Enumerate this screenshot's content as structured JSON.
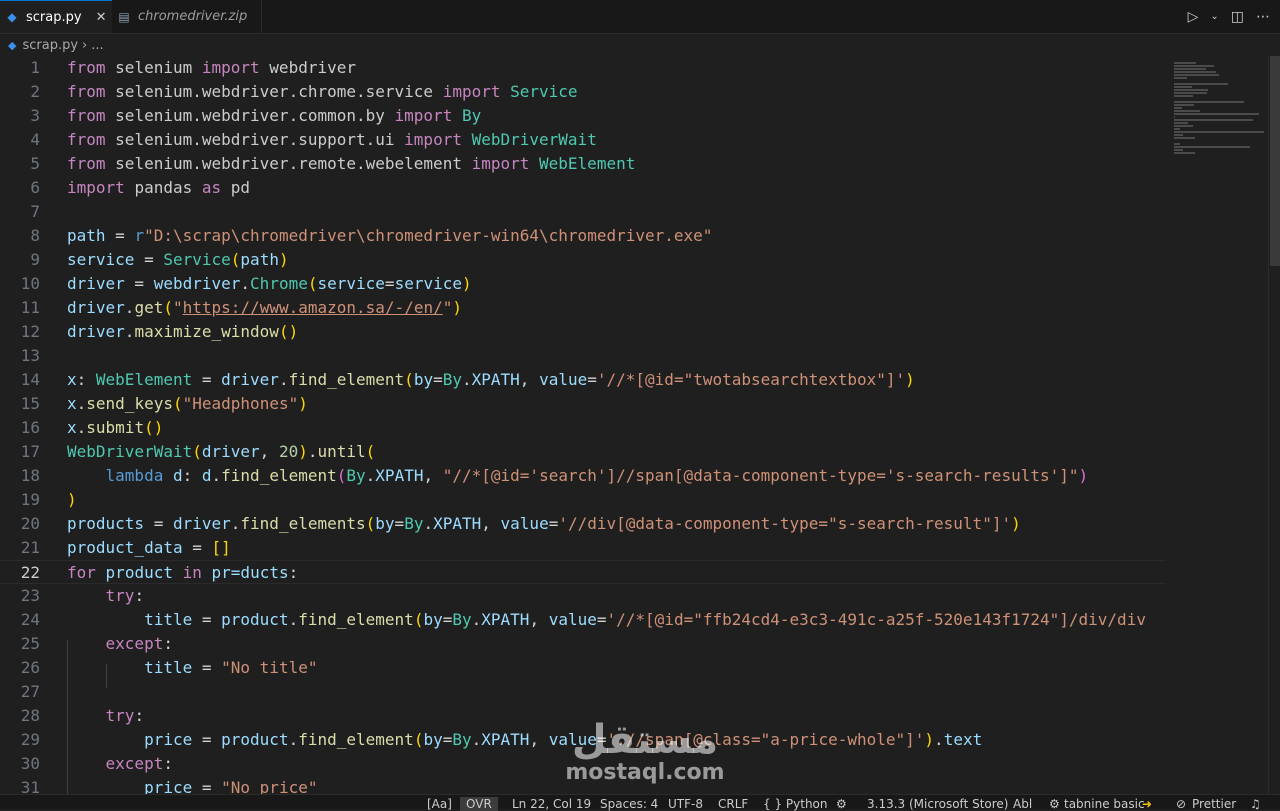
{
  "tabs": [
    {
      "label": "scrap.py",
      "active": true,
      "icon": "python-file-icon"
    },
    {
      "label": "chromedriver.zip",
      "active": false,
      "icon": "zip-file-icon"
    }
  ],
  "breadcrumb": {
    "file": "scrap.py",
    "more": "..."
  },
  "editor": {
    "current_line": "22"
  },
  "code_lines": [
    {
      "n": "1",
      "parts": [
        [
          "kw",
          "from"
        ],
        [
          "",
          "selenium"
        ],
        [
          "kw",
          "import"
        ],
        [
          "",
          "webdriver"
        ]
      ]
    },
    {
      "n": "2",
      "parts": [
        [
          "kw",
          "from"
        ],
        [
          "",
          "selenium.webdriver.chrome.service"
        ],
        [
          "kw",
          "import"
        ],
        [
          "cls",
          "Service"
        ]
      ]
    },
    {
      "n": "3",
      "parts": [
        [
          "kw",
          "from"
        ],
        [
          "",
          "selenium.webdriver.common.by"
        ],
        [
          "kw",
          "import"
        ],
        [
          "cls",
          "By"
        ]
      ]
    },
    {
      "n": "4",
      "parts": [
        [
          "kw",
          "from"
        ],
        [
          "",
          "selenium.webdriver.support.ui"
        ],
        [
          "kw",
          "import"
        ],
        [
          "cls",
          "WebDriverWait"
        ]
      ]
    },
    {
      "n": "5",
      "parts": [
        [
          "kw",
          "from"
        ],
        [
          "",
          "selenium.webdriver.remote.webelement"
        ],
        [
          "kw",
          "import"
        ],
        [
          "cls",
          "WebElement"
        ]
      ]
    },
    {
      "n": "6",
      "parts": [
        [
          "kw",
          "import"
        ],
        [
          "",
          "pandas"
        ],
        [
          "kw",
          "as"
        ],
        [
          "",
          "pd"
        ]
      ]
    },
    {
      "n": "7",
      "parts": []
    },
    {
      "n": "8",
      "parts": [
        [
          "var",
          "path"
        ],
        [
          "op",
          " = "
        ],
        [
          "kb",
          "r"
        ],
        [
          "str",
          "\"D:\\scrap\\chromedriver\\chromedriver-win64\\chromedriver.exe\""
        ]
      ]
    },
    {
      "n": "9",
      "parts": [
        [
          "var",
          "service"
        ],
        [
          "op",
          " = "
        ],
        [
          "cls",
          "Service"
        ],
        [
          "b1",
          "("
        ],
        [
          "var",
          "path"
        ],
        [
          "b1",
          ")"
        ]
      ]
    },
    {
      "n": "10",
      "parts": [
        [
          "var",
          "driver"
        ],
        [
          "op",
          " = "
        ],
        [
          "var",
          "webdriver"
        ],
        [
          "op",
          "."
        ],
        [
          "cls",
          "Chrome"
        ],
        [
          "b1",
          "("
        ],
        [
          "var",
          "service"
        ],
        [
          "op",
          "="
        ],
        [
          "var",
          "service"
        ],
        [
          "b1",
          ")"
        ]
      ]
    },
    {
      "n": "11",
      "parts": [
        [
          "var",
          "driver"
        ],
        [
          "op",
          "."
        ],
        [
          "fn",
          "get"
        ],
        [
          "b1",
          "("
        ],
        [
          "str",
          "\""
        ],
        [
          "str und",
          "https://www.amazon.sa/-/en/"
        ],
        [
          "str",
          "\""
        ],
        [
          "b1",
          ")"
        ]
      ]
    },
    {
      "n": "12",
      "parts": [
        [
          "var",
          "driver"
        ],
        [
          "op",
          "."
        ],
        [
          "fn",
          "maximize_window"
        ],
        [
          "b1",
          "()"
        ]
      ]
    },
    {
      "n": "13",
      "parts": []
    },
    {
      "n": "14",
      "parts": [
        [
          "var",
          "x"
        ],
        [
          "op",
          ": "
        ],
        [
          "cls",
          "WebElement"
        ],
        [
          "op",
          " = "
        ],
        [
          "var",
          "driver"
        ],
        [
          "op",
          "."
        ],
        [
          "fn",
          "find_element"
        ],
        [
          "b1",
          "("
        ],
        [
          "var",
          "by"
        ],
        [
          "op",
          "="
        ],
        [
          "cls",
          "By"
        ],
        [
          "op",
          "."
        ],
        [
          "var",
          "XPATH"
        ],
        [
          "op",
          ", "
        ],
        [
          "var",
          "value"
        ],
        [
          "op",
          "="
        ],
        [
          "str",
          "'//*[@id=\"twotabsearchtextbox\"]'"
        ],
        [
          "b1",
          ")"
        ]
      ]
    },
    {
      "n": "15",
      "parts": [
        [
          "var",
          "x"
        ],
        [
          "op",
          "."
        ],
        [
          "fn",
          "send_keys"
        ],
        [
          "b1",
          "("
        ],
        [
          "str",
          "\"Headphones\""
        ],
        [
          "b1",
          ")"
        ]
      ]
    },
    {
      "n": "16",
      "parts": [
        [
          "var",
          "x"
        ],
        [
          "op",
          "."
        ],
        [
          "fn",
          "submit"
        ],
        [
          "b1",
          "()"
        ]
      ]
    },
    {
      "n": "17",
      "parts": [
        [
          "cls",
          "WebDriverWait"
        ],
        [
          "b1",
          "("
        ],
        [
          "var",
          "driver"
        ],
        [
          "op",
          ", "
        ],
        [
          "num",
          "20"
        ],
        [
          "b1",
          ")"
        ],
        [
          "op",
          "."
        ],
        [
          "fn",
          "until"
        ],
        [
          "b1",
          "("
        ]
      ]
    },
    {
      "n": "18",
      "parts": [
        [
          "op",
          "    "
        ],
        [
          "kb",
          "lambda"
        ],
        [
          "op",
          " "
        ],
        [
          "var",
          "d"
        ],
        [
          "op",
          ": "
        ],
        [
          "var",
          "d"
        ],
        [
          "op",
          "."
        ],
        [
          "fn",
          "find_element"
        ],
        [
          "b2",
          "("
        ],
        [
          "cls",
          "By"
        ],
        [
          "op",
          "."
        ],
        [
          "var",
          "XPATH"
        ],
        [
          "op",
          ", "
        ],
        [
          "str",
          "\"//*[@id='search']//span[@data-component-type='s-search-results']\""
        ],
        [
          "b2",
          ")"
        ]
      ]
    },
    {
      "n": "19",
      "parts": [
        [
          "b1",
          ")"
        ]
      ]
    },
    {
      "n": "20",
      "parts": [
        [
          "var",
          "products"
        ],
        [
          "op",
          " = "
        ],
        [
          "var",
          "driver"
        ],
        [
          "op",
          "."
        ],
        [
          "fn",
          "find_elements"
        ],
        [
          "b1",
          "("
        ],
        [
          "var",
          "by"
        ],
        [
          "op",
          "="
        ],
        [
          "cls",
          "By"
        ],
        [
          "op",
          "."
        ],
        [
          "var",
          "XPATH"
        ],
        [
          "op",
          ", "
        ],
        [
          "var",
          "value"
        ],
        [
          "op",
          "="
        ],
        [
          "str",
          "'//div[@data-component-type=\"s-search-result\"]'"
        ],
        [
          "b1",
          ")"
        ]
      ]
    },
    {
      "n": "21",
      "parts": [
        [
          "var",
          "product_data"
        ],
        [
          "op",
          " = "
        ],
        [
          "b1",
          "[]"
        ]
      ]
    },
    {
      "n": "22",
      "parts": [
        [
          "kw",
          "for"
        ],
        [
          "op",
          " "
        ],
        [
          "var",
          "product"
        ],
        [
          "op",
          " "
        ],
        [
          "kw",
          "in"
        ],
        [
          "op",
          " "
        ],
        [
          "var",
          "pr=ducts"
        ],
        [
          "op",
          ":"
        ]
      ]
    },
    {
      "n": "23",
      "parts": [
        [
          "op",
          "    "
        ],
        [
          "kw",
          "try"
        ],
        [
          "op",
          ":"
        ]
      ]
    },
    {
      "n": "24",
      "parts": [
        [
          "op",
          "        "
        ],
        [
          "var",
          "title"
        ],
        [
          "op",
          " = "
        ],
        [
          "var",
          "product"
        ],
        [
          "op",
          "."
        ],
        [
          "fn",
          "find_element"
        ],
        [
          "b1",
          "("
        ],
        [
          "var",
          "by"
        ],
        [
          "op",
          "="
        ],
        [
          "cls",
          "By"
        ],
        [
          "op",
          "."
        ],
        [
          "var",
          "XPATH"
        ],
        [
          "op",
          ", "
        ],
        [
          "var",
          "value"
        ],
        [
          "op",
          "="
        ],
        [
          "str",
          "'//*[@id=\"ffb24cd4-e3c3-491c-a25f-520e143f1724\"]/div/div"
        ]
      ]
    },
    {
      "n": "25",
      "parts": [
        [
          "op",
          "    "
        ],
        [
          "kw",
          "except"
        ],
        [
          "op",
          ":"
        ]
      ]
    },
    {
      "n": "26",
      "parts": [
        [
          "op",
          "        "
        ],
        [
          "var",
          "title"
        ],
        [
          "op",
          " = "
        ],
        [
          "str",
          "\"No title\""
        ]
      ]
    },
    {
      "n": "27",
      "parts": []
    },
    {
      "n": "28",
      "parts": [
        [
          "op",
          "    "
        ],
        [
          "kw",
          "try"
        ],
        [
          "op",
          ":"
        ]
      ]
    },
    {
      "n": "29",
      "parts": [
        [
          "op",
          "        "
        ],
        [
          "var",
          "price"
        ],
        [
          "op",
          " = "
        ],
        [
          "var",
          "product"
        ],
        [
          "op",
          "."
        ],
        [
          "fn",
          "find_element"
        ],
        [
          "b1",
          "("
        ],
        [
          "var",
          "by"
        ],
        [
          "op",
          "="
        ],
        [
          "cls",
          "By"
        ],
        [
          "op",
          "."
        ],
        [
          "var",
          "XPATH"
        ],
        [
          "op",
          ", "
        ],
        [
          "var",
          "value"
        ],
        [
          "op",
          "="
        ],
        [
          "str",
          "'.//span[@class=\"a-price-whole\"]'"
        ],
        [
          "b1",
          ")"
        ],
        [
          "op",
          "."
        ],
        [
          "var",
          "text"
        ]
      ]
    },
    {
      "n": "30",
      "parts": [
        [
          "op",
          "    "
        ],
        [
          "kw",
          "except"
        ],
        [
          "op",
          ":"
        ]
      ]
    },
    {
      "n": "31",
      "parts": [
        [
          "op",
          "        "
        ],
        [
          "var",
          "price"
        ],
        [
          "op",
          " = "
        ],
        [
          "str",
          "\"No price\""
        ]
      ]
    }
  ],
  "status": {
    "aa": "[Aa]",
    "ovr": "OVR",
    "position": "Ln 22, Col 19",
    "spaces": "Spaces: 4",
    "encoding": "UTF-8",
    "eol": "CRLF",
    "language": "{ } Python",
    "interpreter": "3.13.3 (Microsoft Store)",
    "abl": "Abl",
    "tabnine": "tabnine basic",
    "prettier": "Prettier"
  },
  "watermark": {
    "arabic": "مستقل",
    "latin": "mostaql.com"
  },
  "colors": {
    "accent": "#0078d4",
    "background": "#1f1f1f",
    "keyword": "#c586c0",
    "string": "#ce9178",
    "function": "#dcdcaa",
    "class": "#4ec9b0",
    "variable": "#9cdcfe"
  }
}
